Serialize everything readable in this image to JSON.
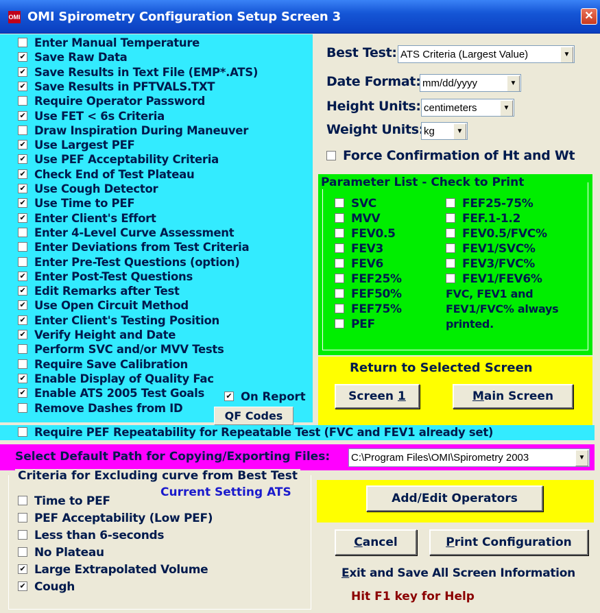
{
  "window": {
    "title": "OMI Spirometry Configuration Setup Screen 3",
    "app_icon": "OMI",
    "close_glyph": "✕"
  },
  "options": [
    {
      "label": "Enter Manual Temperature",
      "checked": false
    },
    {
      "label": "Save Raw Data",
      "checked": true
    },
    {
      "label": "Save Results in Text File (EMP*.ATS)",
      "checked": true
    },
    {
      "label": "Save Results in PFTVALS.TXT",
      "checked": true
    },
    {
      "label": "Require Operator Password",
      "checked": false
    },
    {
      "label": "Use FET <  6s Criteria",
      "checked": true
    },
    {
      "label": "Draw Inspiration During Maneuver",
      "checked": false
    },
    {
      "label": "Use Largest PEF",
      "checked": true
    },
    {
      "label": "Use PEF Acceptability Criteria",
      "checked": true
    },
    {
      "label": "Check End of Test Plateau",
      "checked": true
    },
    {
      "label": "Use Cough Detector",
      "checked": true
    },
    {
      "label": "Use Time to PEF",
      "checked": true
    },
    {
      "label": "Enter Client's Effort",
      "checked": true
    },
    {
      "label": "Enter 4-Level Curve Assessment",
      "checked": false
    },
    {
      "label": "Enter Deviations from Test Criteria",
      "checked": false
    },
    {
      "label": "Enter Pre-Test Questions (option)",
      "checked": false
    },
    {
      "label": "Enter Post-Test Questions",
      "checked": true
    },
    {
      "label": "Edit Remarks after Test",
      "checked": true
    },
    {
      "label": "Use Open Circuit Method",
      "checked": true
    },
    {
      "label": "Enter Client's Testing Position",
      "checked": true
    },
    {
      "label": "Verify Height and Date",
      "checked": true
    },
    {
      "label": "Perform SVC and/or MVV Tests",
      "checked": false
    },
    {
      "label": "Require Save Calibration",
      "checked": false
    },
    {
      "label": "Enable Display of Quality Fac",
      "checked": true
    },
    {
      "label": "Enable ATS 2005 Test Goals",
      "checked": true
    },
    {
      "label": "Remove Dashes from ID",
      "checked": false
    }
  ],
  "on_report": {
    "label": "On Report",
    "checked": true
  },
  "qf_codes_label": "QF Codes",
  "settings": {
    "best_test_label": "Best Test:",
    "best_test_value": "ATS Criteria (Largest Value)",
    "date_format_label": "Date Format:",
    "date_format_value": "mm/dd/yyyy",
    "height_units_label": "Height Units:",
    "height_units_value": "centimeters",
    "weight_units_label": "Weight Units:",
    "weight_units_value": "kg",
    "force_confirm_label": "Force Confirmation of Ht and Wt",
    "force_confirm_checked": false
  },
  "parameters": {
    "title": "Parameter List - Check to Print",
    "left": [
      {
        "label": "SVC",
        "checked": false
      },
      {
        "label": "MVV",
        "checked": false
      },
      {
        "label": "FEV0.5",
        "checked": false
      },
      {
        "label": "FEV3",
        "checked": false
      },
      {
        "label": "FEV6",
        "checked": false
      },
      {
        "label": "FEF25%",
        "checked": false
      },
      {
        "label": "FEF50%",
        "checked": false
      },
      {
        "label": "FEF75%",
        "checked": false
      },
      {
        "label": "PEF",
        "checked": false
      }
    ],
    "right": [
      {
        "label": "FEF25-75%",
        "checked": false
      },
      {
        "label": "FEF.1-1.2",
        "checked": false
      },
      {
        "label": "FEV0.5/FVC%",
        "checked": false
      },
      {
        "label": "FEV1/SVC%",
        "checked": false
      },
      {
        "label": "FEV3/FVC%",
        "checked": false
      },
      {
        "label": "FEV1/FEV6%",
        "checked": false
      }
    ],
    "note_lines": [
      "FVC, FEV1 and",
      "FEV1/FVC% always",
      "printed."
    ]
  },
  "return_panel": {
    "title": "Return to Selected Screen",
    "screen1_prefix": "Screen ",
    "screen1_accel": "1",
    "main_accel": "M",
    "main_rest": "ain Screen"
  },
  "pef_repeat": {
    "label": "Require PEF Repeatability for Repeatable Test (FVC and FEV1 already set)",
    "checked": false
  },
  "path": {
    "label": "Select Default Path for Copying/Exporting Files:",
    "value": "C:\\Program Files\\OMI\\Spirometry 2003"
  },
  "criteria": {
    "title": "Criteria for Excluding curve from Best Test",
    "current_setting": "Current Setting ATS",
    "items": [
      {
        "label": "Time to PEF",
        "checked": false
      },
      {
        "label": "PEF Acceptability (Low PEF)",
        "checked": false
      },
      {
        "label": "Less than 6-seconds",
        "checked": false
      },
      {
        "label": "No Plateau",
        "checked": false
      },
      {
        "label": "Large Extrapolated Volume",
        "checked": true
      },
      {
        "label": "Cough",
        "checked": true
      }
    ]
  },
  "actions": {
    "add_edit_operators": "Add/Edit Operators",
    "cancel_accel": "C",
    "cancel_rest": "ancel",
    "print_accel": "P",
    "print_rest": "rint Configuration",
    "exit_accel": "E",
    "exit_rest": "xit and Save All Screen Information",
    "help": "Hit F1 key for Help"
  },
  "colors": {
    "left_panel": "#33ebff",
    "param_panel": "#00ee00",
    "return_panel": "#ffff00",
    "path_row": "#ff00ff",
    "help_text": "#8b0000",
    "current_setting": "#1a1acc"
  }
}
